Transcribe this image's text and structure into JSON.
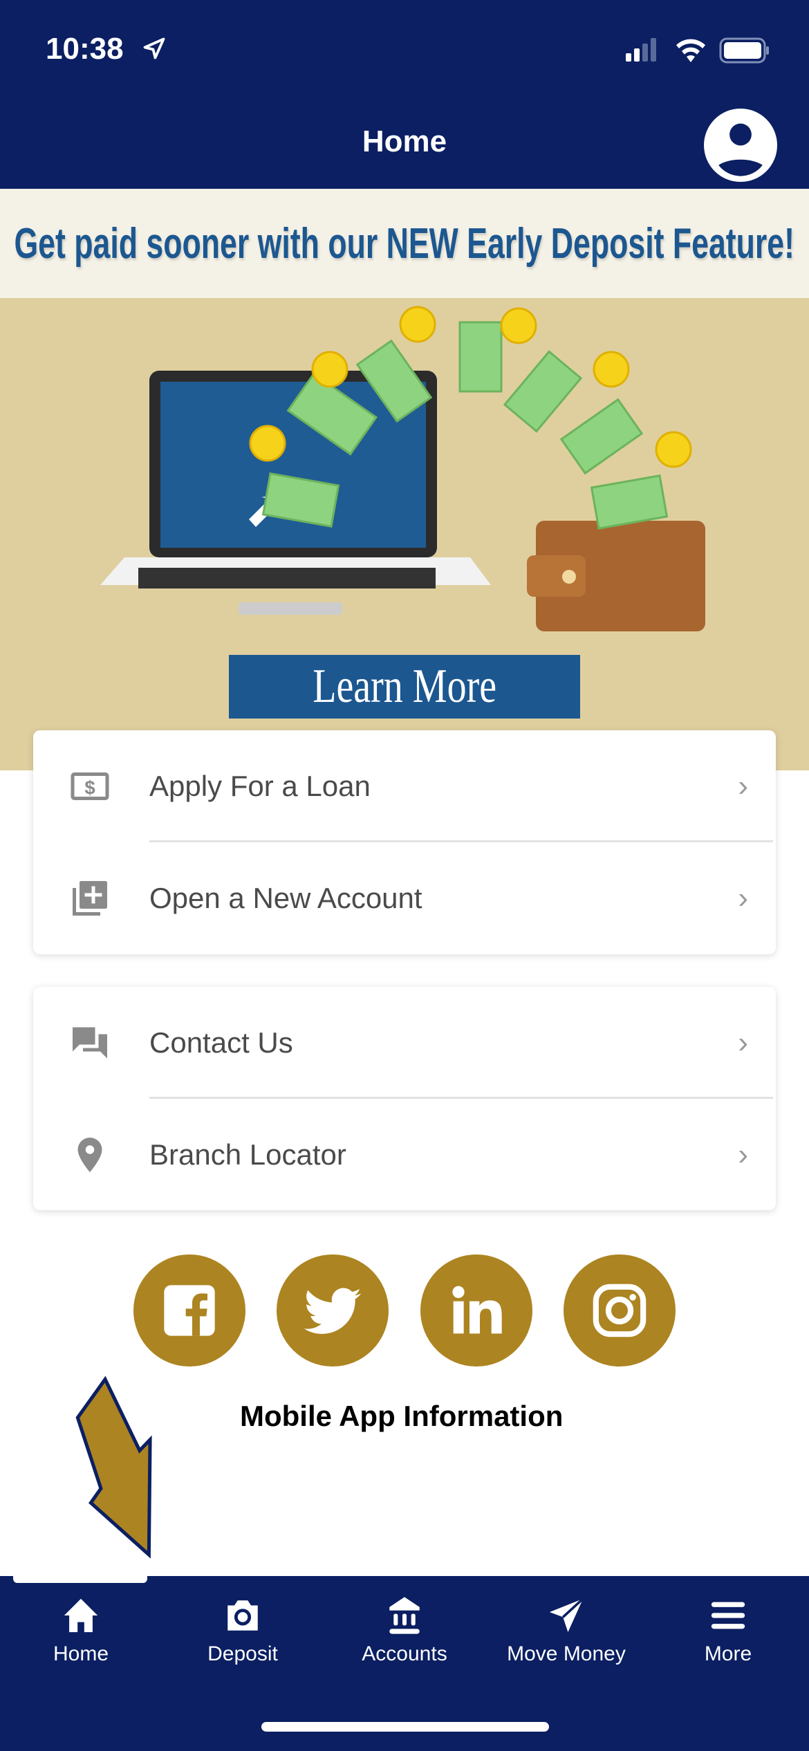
{
  "status_bar": {
    "time": "10:38"
  },
  "header": {
    "title": "Home"
  },
  "promo": {
    "headline": "Get paid sooner with our NEW Early Deposit Feature!",
    "button": "Learn More"
  },
  "card1": [
    {
      "label": "Apply For a Loan",
      "icon": "loan-dollar-icon"
    },
    {
      "label": "Open a New Account",
      "icon": "add-account-icon"
    }
  ],
  "card2": [
    {
      "label": "Contact Us",
      "icon": "chat-icon"
    },
    {
      "label": "Branch Locator",
      "icon": "location-pin-icon"
    }
  ],
  "social": [
    "facebook",
    "twitter",
    "linkedin",
    "instagram"
  ],
  "mobile_info": "Mobile App Information",
  "tabs": [
    {
      "label": "Home"
    },
    {
      "label": "Deposit"
    },
    {
      "label": "Accounts"
    },
    {
      "label": "Move Money"
    },
    {
      "label": "More"
    }
  ],
  "colors": {
    "navy": "#0b1f62",
    "gold": "#ac8421",
    "banner_blue": "#1c5790"
  }
}
